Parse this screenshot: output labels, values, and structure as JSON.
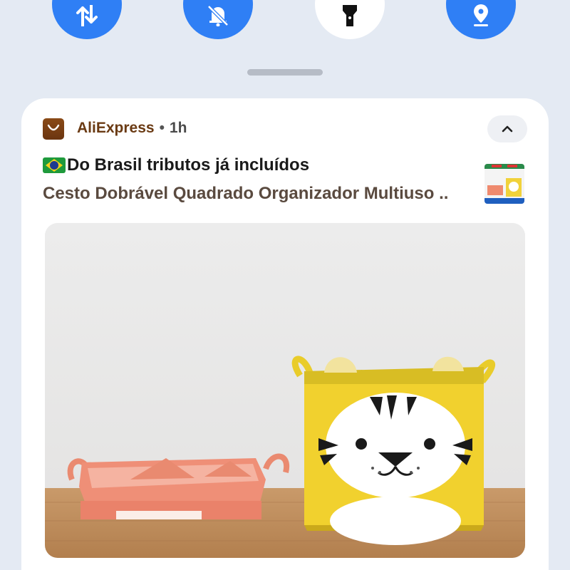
{
  "quick_settings": {
    "tiles": [
      {
        "name": "mobile-data",
        "state": "on",
        "icon": "data-arrows-icon"
      },
      {
        "name": "do-not-disturb",
        "state": "on",
        "icon": "bell-off-icon"
      },
      {
        "name": "flashlight",
        "state": "off",
        "icon": "flashlight-icon"
      },
      {
        "name": "location",
        "state": "on",
        "icon": "location-pin-icon"
      }
    ],
    "accent_color": "#2f7ff5"
  },
  "notification": {
    "app_name": "AliExpress",
    "separator": "•",
    "time": "1h",
    "app_icon": "aliexpress-bag-icon",
    "app_color": "#6b3510",
    "title_flag": "brazil-flag-icon",
    "title": "Do Brasil tributos já incluídos",
    "body": "Cesto Dobrável Quadrado Organizador Multiuso ..",
    "collapse_icon": "chevron-up-icon"
  }
}
